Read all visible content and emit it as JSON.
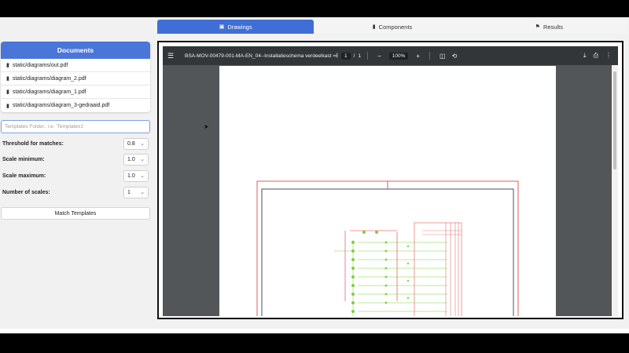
{
  "tabs": [
    {
      "label": "Drawings",
      "icon": "image-icon"
    },
    {
      "label": "Components",
      "icon": "file-icon"
    },
    {
      "label": "Results",
      "icon": "flag-icon"
    }
  ],
  "documents": {
    "header": "Documents",
    "items": [
      "static/diagrams/out.pdf",
      "static/diagrams/diagram_2.pdf",
      "static/diagrams/diagram_1.pdf",
      "static/diagrams/diagram_3-gedraaid.pdf"
    ]
  },
  "templates_input": {
    "placeholder": "Templates Folder.. i.e. 'Templates1'",
    "value": ""
  },
  "params": {
    "threshold": {
      "label": "Threshold for matches:",
      "value": "0.8"
    },
    "scale_min": {
      "label": "Scale minimum:",
      "value": "1.0"
    },
    "scale_max": {
      "label": "Scale maximum:",
      "value": "1.0"
    },
    "num_scales": {
      "label": "Number of scales:",
      "value": "1"
    }
  },
  "match_button": "Match Templates",
  "viewer": {
    "title": "BSA-MOV-00479-001-MA-EN_04--Installatieschema verdeelkast =BSL2 ...",
    "page_current": "1",
    "page_sep": "/",
    "page_total": "1",
    "zoom": "100%"
  }
}
